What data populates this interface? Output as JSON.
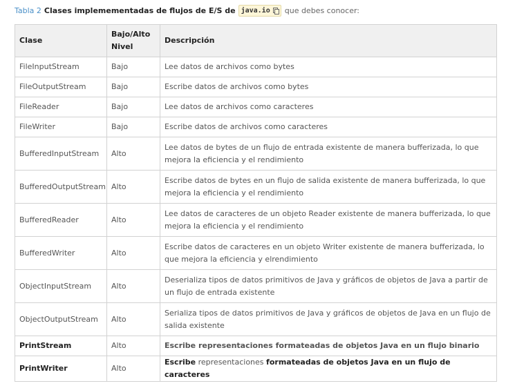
{
  "caption": {
    "label": "Tabla 2",
    "title": "Clases implemementadas de flujos de E/S de",
    "code": "java.io",
    "rest": "que debes conocer:"
  },
  "table": {
    "headers": [
      "Clase",
      "Bajo/Alto Nivel",
      "Descripción"
    ],
    "rows": [
      {
        "clase": "FileInputStream",
        "nivel": "Bajo",
        "descripcion": "Lee datos de archivos como bytes"
      },
      {
        "clase": "FileOutputStream",
        "nivel": "Bajo",
        "descripcion": "Escribe datos de archivos como bytes"
      },
      {
        "clase": "FileReader",
        "nivel": "Bajo",
        "descripcion": "Lee datos de archivos como caracteres"
      },
      {
        "clase": "FileWriter",
        "nivel": "Bajo",
        "descripcion": "Escribe datos de archivos como caracteres"
      },
      {
        "clase": "BufferedInputStream",
        "nivel": "Alto",
        "descripcion": "Lee datos de bytes de un flujo de entrada existente de manera bufferizada, lo que mejora la eficiencia y el rendimiento"
      },
      {
        "clase": "BufferedOutputStream",
        "nivel": "Alto",
        "descripcion": "Escribe datos de bytes en un flujo de salida existente de manera bufferizada, lo que mejora la eficiencia y el rendimiento"
      },
      {
        "clase": "BufferedReader",
        "nivel": "Alto",
        "descripcion": "Lee datos de caracteres de un objeto Reader existente de manera bufferizada, lo que mejora la eficiencia y el rendimiento"
      },
      {
        "clase": "BufferedWriter",
        "nivel": "Alto",
        "descripcion": "Escribe datos de caracteres en un objeto Writer existente de manera bufferizada, lo que mejora la eficiencia y elrendimiento"
      },
      {
        "clase": "ObjectInputStream",
        "nivel": "Alto",
        "descripcion": "Deserializa tipos de datos primitivos de Java y gráficos de objetos de Java a partir de un flujo de entrada existente"
      },
      {
        "clase": "ObjectOutputStream",
        "nivel": "Alto",
        "descripcion": "Serializa tipos de datos primitivos de Java y gráficos de objetos de Java en un flujo de salida existente"
      },
      {
        "clase": "PrintStream",
        "nivel": "Alto",
        "descripcion": "Escribe representaciones formateadas de objetos Java en un flujo binario"
      },
      {
        "clase": "PrintWriter",
        "nivel": "Alto",
        "descripcion_parts": [
          "Escribe",
          "representaciones",
          "formateadas de objetos Java en un flujo de caracteres"
        ]
      }
    ]
  }
}
